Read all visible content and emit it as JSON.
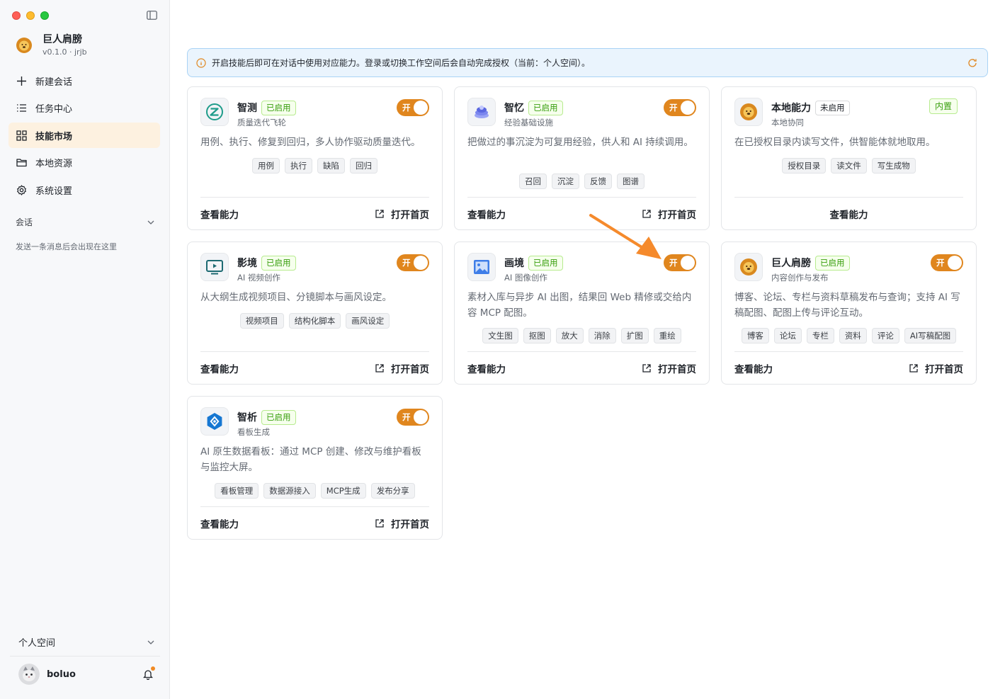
{
  "app": {
    "name": "巨人肩膀",
    "version": "v0.1.0 · jrjb"
  },
  "nav": [
    {
      "label": "新建会话",
      "icon": "plus-icon"
    },
    {
      "label": "任务中心",
      "icon": "list-icon"
    },
    {
      "label": "技能市场",
      "icon": "grid-icon",
      "active": true
    },
    {
      "label": "本地资源",
      "icon": "folder-icon"
    },
    {
      "label": "系统设置",
      "icon": "gear-icon"
    }
  ],
  "sessions": {
    "title": "会话",
    "empty": "发送一条消息后会出现在这里"
  },
  "workspace": {
    "label": "个人空间"
  },
  "user": {
    "name": "boluo"
  },
  "notice": {
    "text": "开启技能后即可在对话中使用对应能力。登录或切换工作空间后会自动完成授权（当前：个人空间）。"
  },
  "labels": {
    "view": "查看能力",
    "open": "打开首页",
    "toggle_on": "开"
  },
  "cards": [
    {
      "name": "智测",
      "badge": "已启用",
      "sub": "质量迭代飞轮",
      "desc": "用例、执行、修复到回归，多人协作驱动质量迭代。",
      "tags": [
        "用例",
        "执行",
        "缺陷",
        "回归"
      ]
    },
    {
      "name": "智忆",
      "badge": "已启用",
      "sub": "经验基础设施",
      "desc": "把做过的事沉淀为可复用经验，供人和 AI 持续调用。",
      "tags": [
        "召回",
        "沉淀",
        "反馈",
        "图谱"
      ]
    },
    {
      "name": "本地能力",
      "badge": "未启用",
      "sub": "本地协同",
      "desc": "在已授权目录内读写文件，供智能体就地取用。",
      "tags": [
        "授权目录",
        "读文件",
        "写生成物"
      ],
      "builtin": "内置"
    },
    {
      "name": "影境",
      "badge": "已启用",
      "sub": "AI 视频创作",
      "desc": "从大纲生成视频项目、分镜脚本与画风设定。",
      "tags": [
        "视频项目",
        "结构化脚本",
        "画风设定"
      ]
    },
    {
      "name": "画境",
      "badge": "已启用",
      "sub": "AI 图像创作",
      "desc": "素材入库与异步 AI 出图，结果回 Web 精修或交给内容 MCP 配图。",
      "tags": [
        "文生图",
        "抠图",
        "放大",
        "消除",
        "扩图",
        "重绘"
      ]
    },
    {
      "name": "巨人肩膀",
      "badge": "已启用",
      "sub": "内容创作与发布",
      "desc": "博客、论坛、专栏与资料草稿发布与查询；支持 AI 写稿配图、配图上传与评论互动。",
      "tags": [
        "博客",
        "论坛",
        "专栏",
        "资料",
        "评论",
        "AI写稿配图"
      ]
    },
    {
      "name": "智析",
      "badge": "已启用",
      "sub": "看板生成",
      "desc": "AI 原生数据看板：通过 MCP 创建、修改与维护看板与监控大屏。",
      "tags": [
        "看板管理",
        "数据源接入",
        "MCP生成",
        "发布分享"
      ]
    }
  ],
  "colors": {
    "accent": "#e0861e",
    "active_nav_bg": "#fdf1e0",
    "enabled_green": "#389e0d",
    "notice_bg": "#eaf4fd",
    "annotation_arrow": "#f58a2c"
  }
}
